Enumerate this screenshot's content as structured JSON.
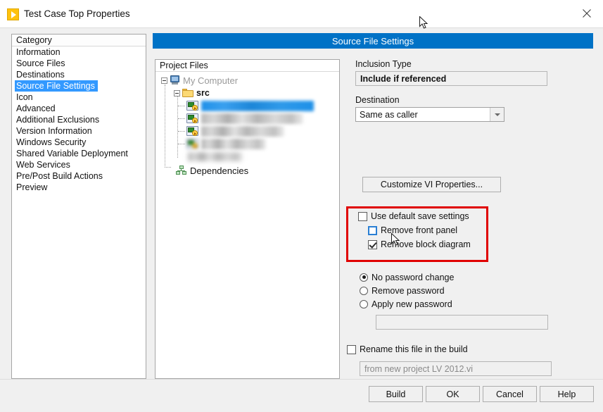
{
  "window": {
    "title": "Test Case Top Properties",
    "app_icon": "labview-vi-icon",
    "close_label": "close-icon"
  },
  "banner": {
    "title": "Source File Settings"
  },
  "category": {
    "header": "Category",
    "items": [
      {
        "label": "Information",
        "selected": false
      },
      {
        "label": "Source Files",
        "selected": false
      },
      {
        "label": "Destinations",
        "selected": false
      },
      {
        "label": "Source File Settings",
        "selected": true
      },
      {
        "label": "Icon",
        "selected": false
      },
      {
        "label": "Advanced",
        "selected": false
      },
      {
        "label": "Additional Exclusions",
        "selected": false
      },
      {
        "label": "Version Information",
        "selected": false
      },
      {
        "label": "Windows Security",
        "selected": false
      },
      {
        "label": "Shared Variable Deployment",
        "selected": false
      },
      {
        "label": "Web Services",
        "selected": false
      },
      {
        "label": "Pre/Post Build Actions",
        "selected": false
      },
      {
        "label": "Preview",
        "selected": false
      }
    ]
  },
  "project_files": {
    "header": "Project Files",
    "root": {
      "label": "My Computer",
      "icon": "computer-icon",
      "expanded": true
    },
    "folder": {
      "label": "src",
      "icon": "folder-icon",
      "expanded": true
    },
    "files": [
      {
        "label": "",
        "redacted": true,
        "selected": true,
        "icon": "vi-icon"
      },
      {
        "label": "",
        "redacted": true,
        "selected": false,
        "icon": "vi-icon"
      },
      {
        "label": "",
        "redacted": true,
        "selected": false,
        "icon": "vi-icon"
      },
      {
        "label": "",
        "redacted": true,
        "selected": false,
        "icon": "vi-icon"
      }
    ],
    "dependencies": {
      "label": "Dependencies",
      "icon": "dependencies-icon"
    }
  },
  "settings": {
    "inclusion_type_label": "Inclusion Type",
    "inclusion_type_value": "Include if referenced",
    "destination_label": "Destination",
    "destination_value": "Same as caller",
    "customize_button": "Customize VI Properties...",
    "save_settings": {
      "use_default": {
        "label": "Use default save settings",
        "checked": false
      },
      "remove_front_panel": {
        "label": "Remove front panel",
        "checked": false,
        "hover": true
      },
      "remove_block_diagram": {
        "label": "Remove block diagram",
        "checked": true
      }
    },
    "password": {
      "no_change": {
        "label": "No password change",
        "selected": true
      },
      "remove": {
        "label": "Remove password",
        "selected": false
      },
      "apply_new": {
        "label": "Apply new password",
        "selected": false
      },
      "field_value": ""
    },
    "rename": {
      "label": "Rename this file in the build",
      "checked": false,
      "value": "from new project LV 2012.vi"
    }
  },
  "buttons": {
    "build": "Build",
    "ok": "OK",
    "cancel": "Cancel",
    "help": "Help"
  },
  "colors": {
    "banner_blue": "#0072c6",
    "selection_blue": "#3399ff",
    "annotation_red": "#e00000",
    "icon_yellow": "#ffc20e"
  }
}
